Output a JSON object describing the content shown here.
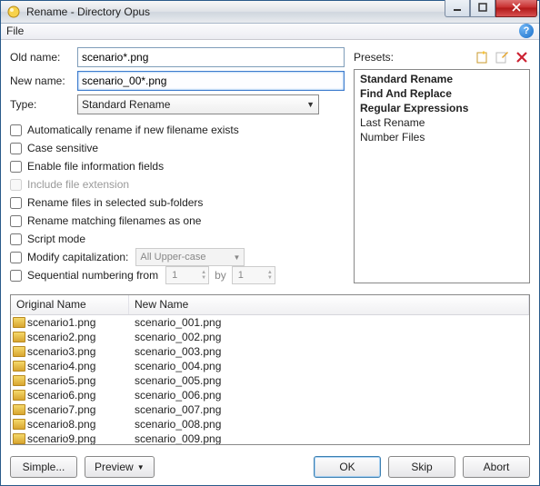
{
  "window_title": "Rename - Directory Opus",
  "menu": {
    "file": "File"
  },
  "labels": {
    "old_name": "Old name:",
    "new_name": "New name:",
    "type": "Type:",
    "presets": "Presets:"
  },
  "fields": {
    "old_name": "scenario*.png",
    "new_name": "scenario_00*.png",
    "type_value": "Standard Rename"
  },
  "checks": {
    "auto_rename": "Automatically rename if new filename exists",
    "case_sensitive": "Case sensitive",
    "enable_info": "Enable file information fields",
    "include_ext": "Include file extension",
    "rename_sub": "Rename files in selected sub-folders",
    "rename_matching": "Rename matching filenames as one",
    "script_mode": "Script mode",
    "modify_cap": "Modify capitalization:",
    "modify_cap_value": "All Upper-case",
    "seq_num": "Sequential numbering from",
    "seq_start": "1",
    "seq_by_label": "by",
    "seq_by": "1"
  },
  "presets": {
    "items": [
      {
        "label": "Standard Rename",
        "bold": true
      },
      {
        "label": "Find And Replace",
        "bold": true
      },
      {
        "label": "Regular Expressions",
        "bold": true
      },
      {
        "label": "Last Rename",
        "bold": false
      },
      {
        "label": "Number Files",
        "bold": false
      }
    ]
  },
  "preview": {
    "col1": "Original Name",
    "col2": "New Name",
    "rows": [
      {
        "orig": "scenario1.png",
        "new": "scenario_001.png"
      },
      {
        "orig": "scenario2.png",
        "new": "scenario_002.png"
      },
      {
        "orig": "scenario3.png",
        "new": "scenario_003.png"
      },
      {
        "orig": "scenario4.png",
        "new": "scenario_004.png"
      },
      {
        "orig": "scenario5.png",
        "new": "scenario_005.png"
      },
      {
        "orig": "scenario6.png",
        "new": "scenario_006.png"
      },
      {
        "orig": "scenario7.png",
        "new": "scenario_007.png"
      },
      {
        "orig": "scenario8.png",
        "new": "scenario_008.png"
      },
      {
        "orig": "scenario9.png",
        "new": "scenario_009.png"
      }
    ]
  },
  "buttons": {
    "simple": "Simple...",
    "preview": "Preview",
    "ok": "OK",
    "skip": "Skip",
    "abort": "Abort"
  }
}
